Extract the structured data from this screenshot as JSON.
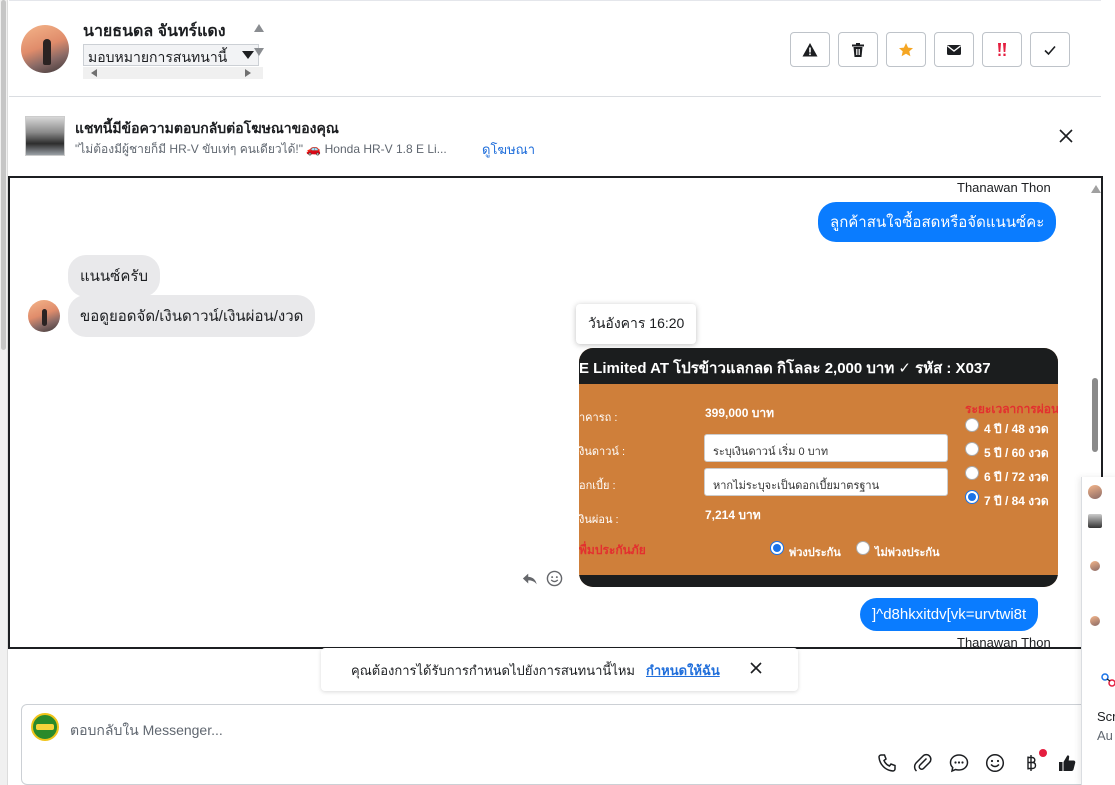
{
  "header": {
    "contact_name": "นายธนดล จันทร์แดง",
    "assign_select_value": "มอบหมายการสนทนานี้",
    "buttons": [
      {
        "name": "report-spam-button",
        "icon": "warning-icon"
      },
      {
        "name": "delete-button",
        "icon": "trash-icon"
      },
      {
        "name": "star-button",
        "icon": "star-icon"
      },
      {
        "name": "mark-unread-button",
        "icon": "envelope-icon"
      },
      {
        "name": "mark-important-button",
        "icon": "double-exclamation-icon"
      },
      {
        "name": "mark-done-button",
        "icon": "checkmark-icon"
      }
    ]
  },
  "ad_banner": {
    "title": "แชทนี้มีข้อความตอบกลับต่อโฆษณาของคุณ",
    "subtitle": "\"ไม่ต้องมีผู้ชายก็มี HR-V ขับเท่ๆ คนเดียวได้!\" 🚗 Honda HR-V 1.8 E Li...",
    "link": "ดูโฆษณา"
  },
  "messages": {
    "sender_top": "Thanawan Thon",
    "out_1": "ลูกค้าสนใจซื้อสดหรือจัดแนนซ์คะ",
    "in_1": "แนนซ์ครับ",
    "in_2": "ขอดูยอดจัด/เงินดาวน์/เงินผ่อน/งวด",
    "timestamp_tooltip": "วันอังคาร 16:20",
    "out_2": "]^d8hkxitdv[vk=urvtwi8t",
    "sender_bottom": "Thanawan Thon"
  },
  "loan_card": {
    "header": "E Limited AT โปรข้าวแลกลด กิโลละ 2,000 บาท ✓ รหัส : X037",
    "price_label": "าคารถ :",
    "price_value": "399,000 บาท",
    "down_label": "งินดาวน์ :",
    "down_placeholder": "ระบุเงินดาวน์ เริ่ม 0 บาท",
    "interest_label": "อกเบี้ย :",
    "interest_placeholder": "หากไม่ระบุจะเป็นดอกเบี้ยมาตรฐาน",
    "installment_label": "งินผ่อน :",
    "installment_value": "7,214 บาท",
    "insurance_label": "พื่มประกันภัย",
    "insurance_yes": "พ่วงประกัน",
    "insurance_no": "ไม่พ่วงประกัน",
    "term_title": "ระยะเวลาการผ่อน",
    "terms": [
      "4 ปี / 48 งวด",
      "5 ปี / 60 งวด",
      "6 ปี / 72 งวด",
      "7 ปี / 84 งวด"
    ],
    "selected_term_index": 3,
    "insurance_selected": "พ่วงประกัน"
  },
  "reminder": {
    "text": "คุณต้องการได้รับการกำหนดไปยังการสนทนานี้ไหม",
    "link": "กำหนดให้ฉัน"
  },
  "composer": {
    "placeholder": "ตอบกลับใน Messenger...",
    "tools": [
      "phone-icon",
      "paperclip-icon",
      "chat-bubble-icon",
      "emoji-icon",
      "baht-icon",
      "thumbs-up-icon"
    ]
  },
  "right_panel": {
    "text_1": "Scr",
    "text_2": "Au"
  },
  "colors": {
    "outgoing_bubble": "#0a7cff",
    "incoming_bubble": "#e9e9eb",
    "link": "#216fdb",
    "loan_card_bg": "#cf7f3a",
    "important_red": "#e41e3f",
    "star_orange": "#f5a623"
  }
}
